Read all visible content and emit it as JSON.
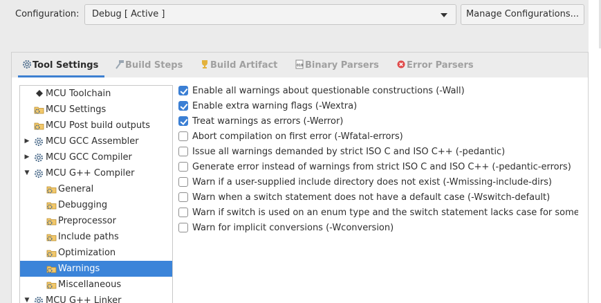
{
  "configuration": {
    "label": "Configuration:",
    "selected": "Debug  [ Active ]",
    "manage_button": "Manage Configurations..."
  },
  "tabs": [
    {
      "label": "Tool Settings",
      "icon": "gear-icon",
      "active": true
    },
    {
      "label": "Build Steps",
      "icon": "hammer-icon",
      "active": false
    },
    {
      "label": "Build Artifact",
      "icon": "trophy-icon",
      "active": false
    },
    {
      "label": "Binary Parsers",
      "icon": "binary-file-icon",
      "active": false
    },
    {
      "label": "Error Parsers",
      "icon": "error-icon",
      "active": false
    }
  ],
  "tree": [
    {
      "label": "MCU Toolchain",
      "icon": "toolchain-icon",
      "level": 1,
      "expander": ""
    },
    {
      "label": "MCU Settings",
      "icon": "settings-folder-icon",
      "level": 1,
      "expander": ""
    },
    {
      "label": "MCU Post build outputs",
      "icon": "settings-folder-icon",
      "level": 1,
      "expander": ""
    },
    {
      "label": "MCU GCC Assembler",
      "icon": "gear-icon",
      "level": 1,
      "expander": "collapsed"
    },
    {
      "label": "MCU GCC Compiler",
      "icon": "gear-icon",
      "level": 1,
      "expander": "collapsed"
    },
    {
      "label": "MCU G++ Compiler",
      "icon": "gear-icon",
      "level": 1,
      "expander": "expanded"
    },
    {
      "label": "General",
      "icon": "settings-folder-icon",
      "level": 2,
      "expander": ""
    },
    {
      "label": "Debugging",
      "icon": "settings-folder-icon",
      "level": 2,
      "expander": ""
    },
    {
      "label": "Preprocessor",
      "icon": "settings-folder-icon",
      "level": 2,
      "expander": ""
    },
    {
      "label": "Include paths",
      "icon": "settings-folder-icon",
      "level": 2,
      "expander": ""
    },
    {
      "label": "Optimization",
      "icon": "settings-folder-icon",
      "level": 2,
      "expander": ""
    },
    {
      "label": "Warnings",
      "icon": "settings-folder-icon",
      "level": 2,
      "expander": "",
      "selected": true
    },
    {
      "label": "Miscellaneous",
      "icon": "settings-folder-icon",
      "level": 2,
      "expander": ""
    },
    {
      "label": "MCU G++ Linker",
      "icon": "gear-icon",
      "level": 1,
      "expander": "expanded"
    }
  ],
  "warnings": [
    {
      "label": "Enable all warnings about questionable constructions (-Wall)",
      "checked": true
    },
    {
      "label": "Enable extra warning flags (-Wextra)",
      "checked": true
    },
    {
      "label": "Treat warnings as errors (-Werror)",
      "checked": true
    },
    {
      "label": "Abort compilation on first error (-Wfatal-errors)",
      "checked": false
    },
    {
      "label": "Issue all warnings demanded by strict ISO C and ISO C++ (-pedantic)",
      "checked": false
    },
    {
      "label": "Generate error instead of warnings from strict ISO C and ISO C++ (-pedantic-errors)",
      "checked": false
    },
    {
      "label": "Warn if a user-supplied include directory does not exist (-Wmissing-include-dirs)",
      "checked": false
    },
    {
      "label": "Warn when a switch statement does not have a default case (-Wswitch-default)",
      "checked": false
    },
    {
      "label": "Warn if switch is used on an enum type and the switch statement lacks case for some",
      "checked": false
    },
    {
      "label": "Warn for implicit conversions (-Wconversion)",
      "checked": false
    }
  ],
  "colors": {
    "accent": "#3b84d9",
    "selection": "#3b84d9",
    "check": "#3b7fd4"
  }
}
